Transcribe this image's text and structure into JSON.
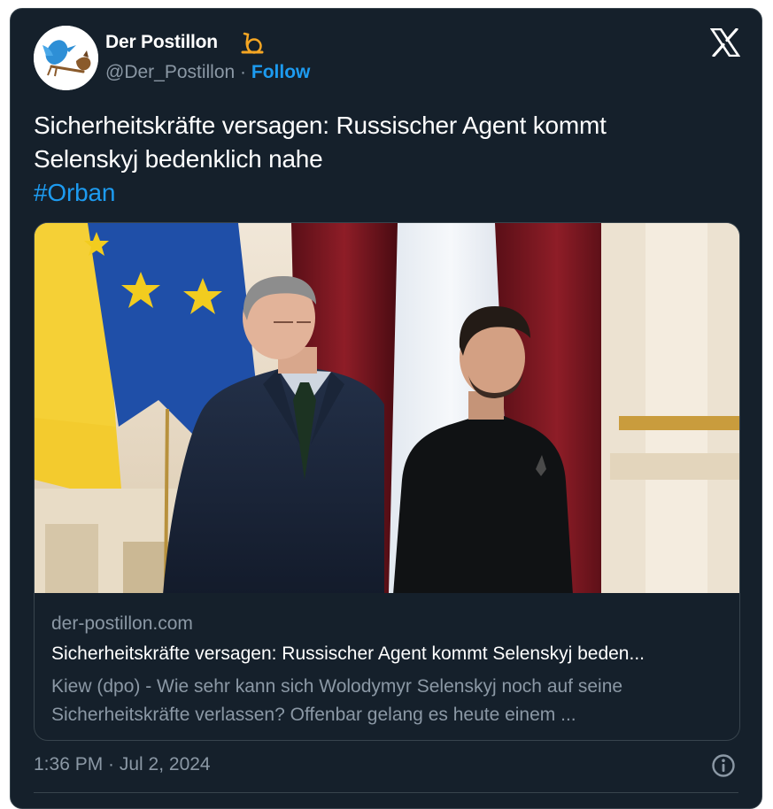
{
  "tweet": {
    "author_name": "Der Postillon",
    "handle": "@Der_Postillon",
    "separator": " · ",
    "follow_label": "Follow",
    "text_line1": "Sicherheitskräfte versagen: Russischer Agent kommt",
    "text_line2": "Selenskyj bedenklich nahe",
    "hashtag": "#Orban",
    "timestamp": "1:36 PM · Jul 2, 2024"
  },
  "link_card": {
    "domain": "der-postillon.com",
    "title": "Sicherheitskräfte versagen: Russischer Agent kommt Selenskyj beden...",
    "description": "Kiew (dpo) - Wie sehr kann sich Wolodymyr Selenskyj noch auf seine Sicherheitskräfte verlassen? Offenbar gelang es heute einem ..."
  },
  "icons": {
    "brand": "x-logo-icon",
    "badge": "post-horn-icon",
    "info": "info-icon"
  },
  "colors": {
    "background": "#15202b",
    "accent": "#1d9bf0",
    "muted_text": "#8b98a5",
    "border": "#38444d"
  }
}
